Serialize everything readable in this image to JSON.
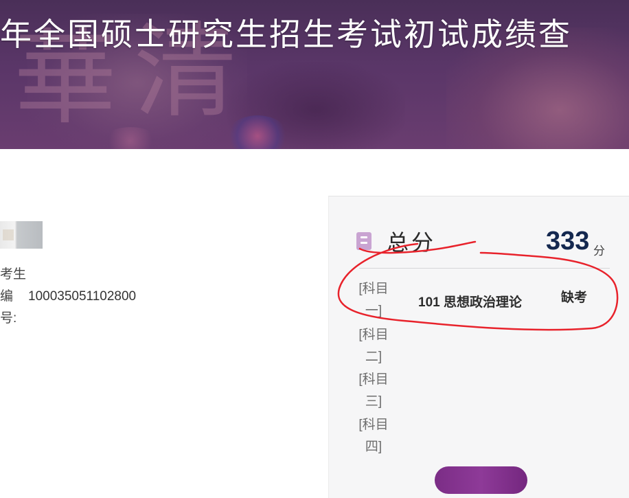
{
  "banner": {
    "title": "年全国硕士研究生招生考试初试成绩查"
  },
  "candidate": {
    "type_label": "考生",
    "id_label": "编",
    "id_value": "100035051102800",
    "number_label": "号:"
  },
  "score_panel": {
    "total_label": "总分",
    "total_score": "333",
    "total_unit": "分",
    "subjects": [
      {
        "label": "[科目一]",
        "name": "101 思想政治理论",
        "status": "缺考"
      },
      {
        "label": "[科目二]"
      },
      {
        "label": "[科目三]"
      },
      {
        "label": "[科目四]"
      }
    ]
  },
  "annotation": {
    "color": "#e8222b"
  },
  "colors": {
    "banner": "#5a3668",
    "accent": "#8e3a98",
    "score": "#14284f"
  }
}
